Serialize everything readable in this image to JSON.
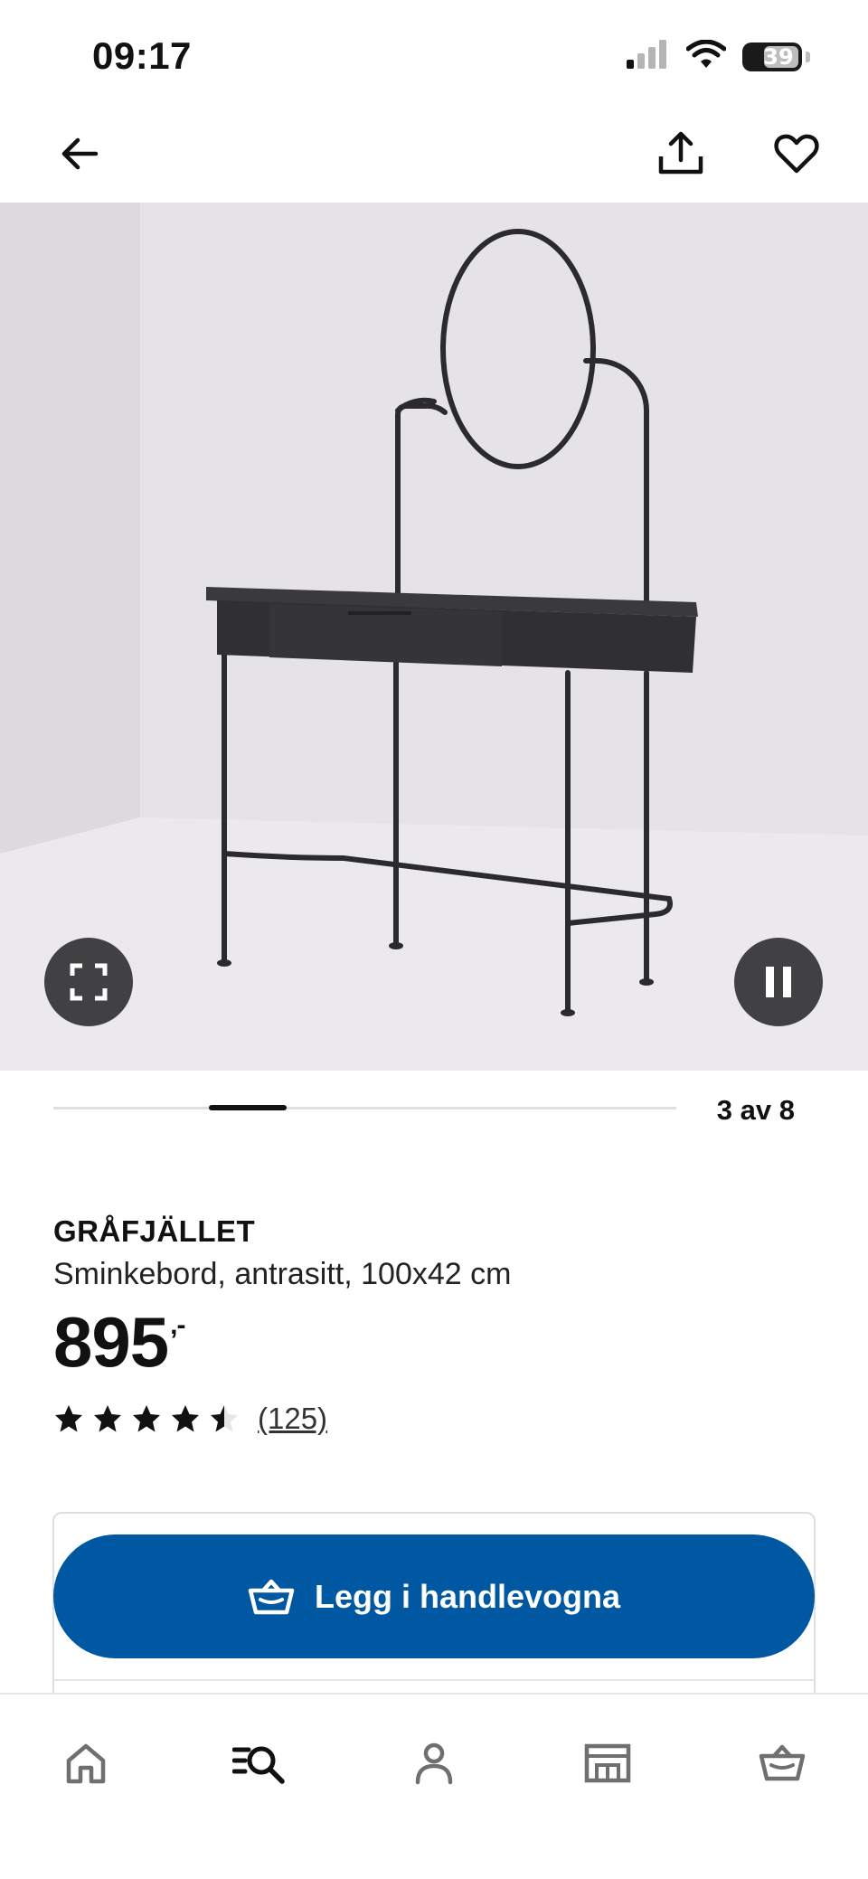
{
  "status_bar": {
    "time": "09:17",
    "battery": "39",
    "icons": [
      "signal-icon",
      "wifi-icon",
      "battery-icon"
    ]
  },
  "nav": {
    "icons": [
      "back-arrow-icon",
      "share-icon",
      "heart-icon"
    ]
  },
  "media": {
    "controls": [
      "fullscreen-icon",
      "pause-icon"
    ],
    "carousel": {
      "position_text": "3 av 8",
      "current": 3,
      "total": 8
    }
  },
  "product": {
    "name": "GRÅFJÄLLET",
    "description": "Sminkebord, antrasitt, 100x42 cm",
    "price": "895",
    "price_suffix": ",-",
    "rating": 4.5,
    "rating_max": 5,
    "review_count": "(125)"
  },
  "cart": {
    "button_label": "Legg i handlevogna",
    "icon": "shopping-basket-icon"
  },
  "tab_bar": {
    "active": "search",
    "items": [
      "home-icon",
      "search-icon",
      "profile-icon",
      "store-icon",
      "basket-icon"
    ]
  },
  "colors": {
    "primary": "#0058a3",
    "text": "#111111",
    "divider": "#dfdfdf"
  }
}
